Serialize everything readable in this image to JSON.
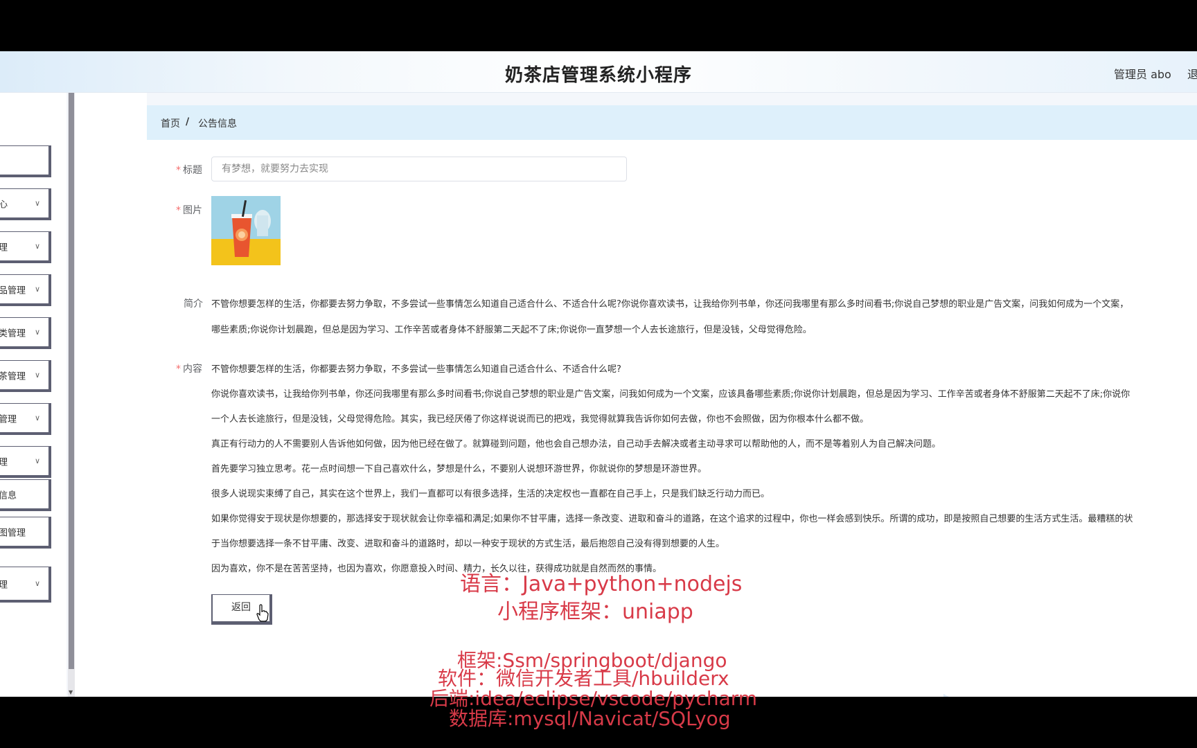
{
  "header": {
    "title": "奶茶店管理系统小程序",
    "user": "管理员 abo",
    "logout": "退"
  },
  "sidebar": {
    "items": [
      {
        "label": "",
        "chevron": false
      },
      {
        "label": "心",
        "chevron": true
      },
      {
        "label": "理",
        "chevron": true
      },
      {
        "label": "品管理",
        "chevron": true
      },
      {
        "label": "类管理",
        "chevron": true
      },
      {
        "label": "茶管理",
        "chevron": true
      },
      {
        "label": "管理",
        "chevron": true
      },
      {
        "label": "理",
        "chevron": true
      },
      {
        "label": "信息",
        "chevron": false
      },
      {
        "label": "图管理",
        "chevron": false
      },
      {
        "label": "理",
        "chevron": true
      }
    ]
  },
  "breadcrumb": {
    "home": "首页",
    "separator": "/",
    "current": "公告信息"
  },
  "form": {
    "title_label": "标题",
    "title_value": "有梦想，就要努力去实现",
    "image_label": "图片",
    "intro_label": "简介",
    "intro_lines": [
      "不管你想要怎样的生活，你都要去努力争取，不多尝试一些事情怎么知道自己适合什么、不适合什么呢?你说你喜欢读书，让我给你列书单，你还问我哪里有那么多时间看书;你说自己梦想的职业是广告文案，问我如何成为一个文案，",
      "哪些素质;你说你计划晨跑，但总是因为学习、工作辛苦或者身体不舒服第二天起不了床;你说你一直梦想一个人去长途旅行，但是没钱，父母觉得危险。"
    ],
    "content_label": "内容",
    "content_lines": [
      "不管你想要怎样的生活，你都要去努力争取，不多尝试一些事情怎么知道自己适合什么、不适合什么呢?",
      "你说你喜欢读书，让我给你列书单，你还问我哪里有那么多时间看书;你说自己梦想的职业是广告文案，问我如何成为一个文案，应该具备哪些素质;你说你计划晨跑，但总是因为学习、工作辛苦或者身体不舒服第二天起不了床;你说你",
      "一个人去长途旅行，但是没钱，父母觉得危险。其实，我已经厌倦了你这样说说而已的把戏，我觉得就算我告诉你如何去做，你也不会照做，因为你根本什么都不做。",
      "真正有行动力的人不需要别人告诉他如何做，因为他已经在做了。就算碰到问题，他也会自己想办法，自己动手去解决或者主动寻求可以帮助他的人，而不是等着别人为自己解决问题。",
      "首先要学习独立思考。花一点时间想一下自己喜欢什么，梦想是什么，不要别人说想环游世界，你就说你的梦想是环游世界。",
      "很多人说现实束缚了自己，其实在这个世界上，我们一直都可以有很多选择，生活的决定权也一直都在自己手上，只是我们缺乏行动力而已。",
      "如果你觉得安于现状是你想要的，那选择安于现状就会让你幸福和满足;如果你不甘平庸，选择一条改变、进取和奋斗的道路，在这个追求的过程中，你也一样会感到快乐。所谓的成功，即是按照自己想要的生活方式生活。最糟糕的状",
      "于当你想要选择一条不甘平庸、改变、进取和奋斗的道路时，却以一种安于现状的方式生活，最后抱怨自己没有得到想要的人生。",
      "因为喜欢，你不是在苦苦坚持，也因为喜欢，你愿意投入时间、精力，长久以往，获得成功就是自然而然的事情。"
    ],
    "back_button": "返回"
  },
  "overlay": {
    "line1": "语言：Java+python+nodejs",
    "line2": "小程序框架：uniapp",
    "line3": "框架:Ssm/springboot/django",
    "line4": "软件：微信开发者工具/hbuilderx",
    "line5": "后端:idea/eclipse/vscode/pycharm",
    "line6": "数据库:mysql/Navicat/SQLyog",
    "color": "#d83a48"
  }
}
